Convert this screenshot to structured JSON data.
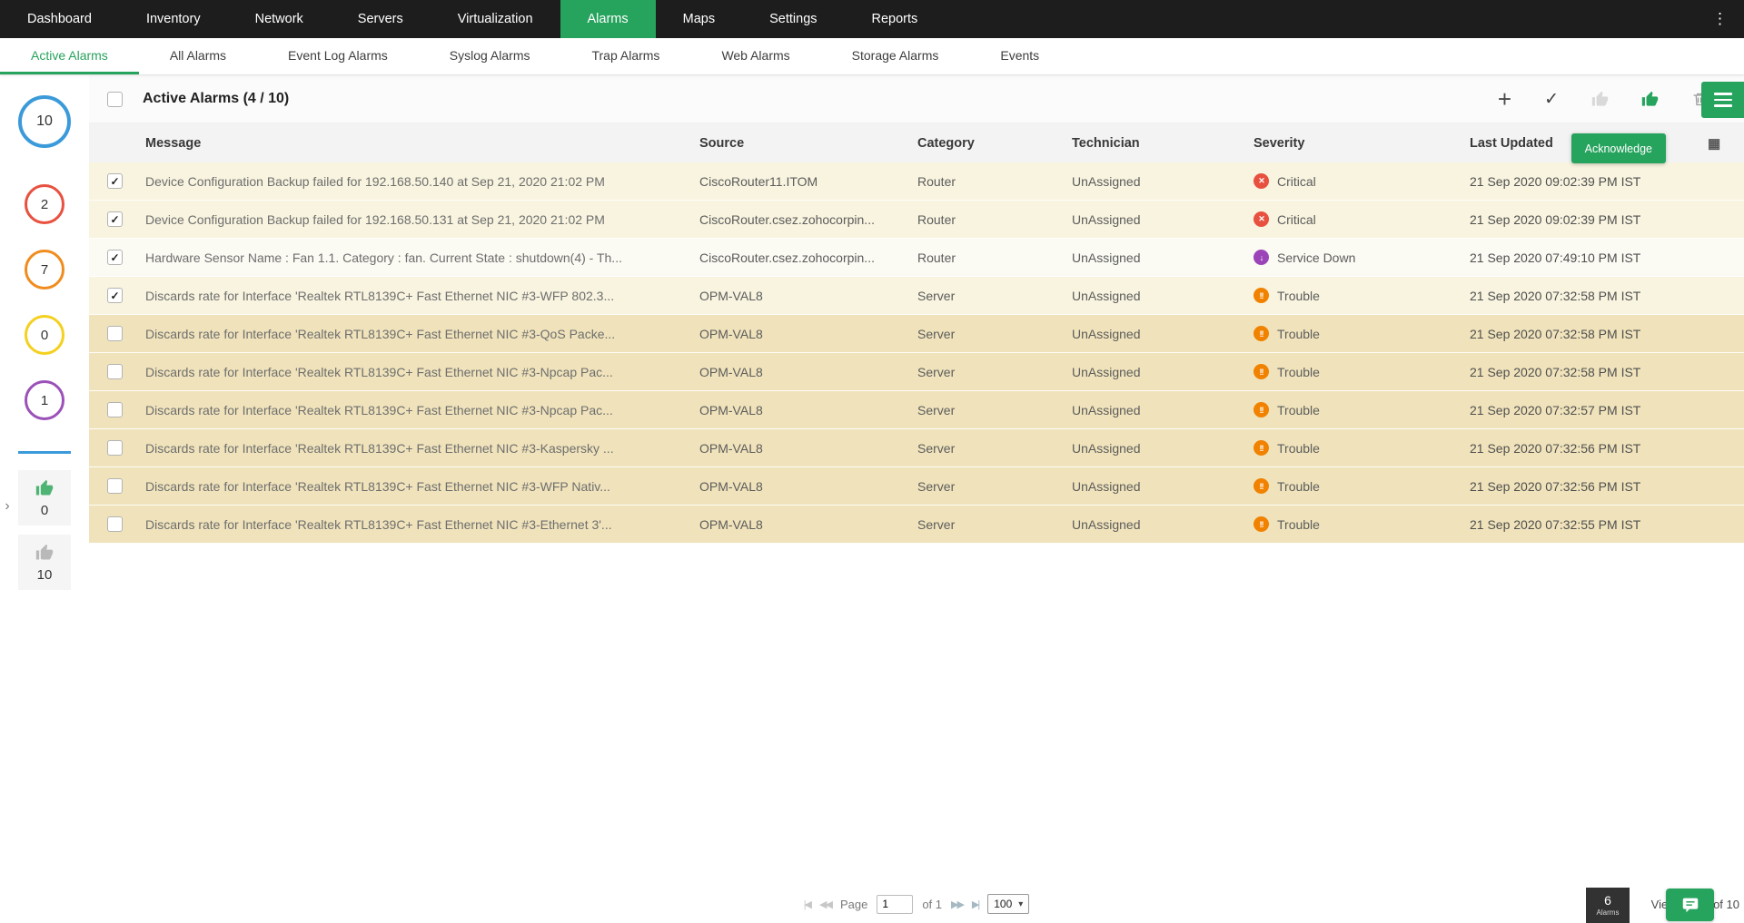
{
  "colors": {
    "accent": "#26a35d",
    "topnav_bg": "#1d1d1d"
  },
  "icons": {
    "overflow_menu": "⋮",
    "plus": "+",
    "check": "✓",
    "grid": "▦",
    "chevron": "›",
    "caret": "▾"
  },
  "topnav": {
    "active": "Alarms",
    "items": [
      "Dashboard",
      "Inventory",
      "Network",
      "Servers",
      "Virtualization",
      "Alarms",
      "Maps",
      "Settings",
      "Reports"
    ]
  },
  "subnav": {
    "active": "Active Alarms",
    "items": [
      "Active Alarms",
      "All Alarms",
      "Event Log Alarms",
      "Syslog Alarms",
      "Trap Alarms",
      "Web Alarms",
      "Storage Alarms",
      "Events"
    ]
  },
  "sidebar": {
    "severity_counts": [
      {
        "name": "all",
        "count": "10",
        "color": "#3b9ad9",
        "large": true
      },
      {
        "name": "critical",
        "count": "2",
        "color": "#e8503f",
        "large": false
      },
      {
        "name": "trouble",
        "count": "7",
        "color": "#f08c1e",
        "large": false
      },
      {
        "name": "attention",
        "count": "0",
        "color": "#f4d01f",
        "large": false
      },
      {
        "name": "service-down",
        "count": "1",
        "color": "#9b51b8",
        "large": false
      }
    ],
    "ack_stats": [
      {
        "name": "acknowledged",
        "count": "0",
        "color": "#4db474"
      },
      {
        "name": "unacknowledged",
        "count": "10",
        "color": "#b9b9b9"
      }
    ]
  },
  "header": {
    "title": "Active Alarms (4 / 10)",
    "tooltip": "Acknowledge"
  },
  "table": {
    "columns": {
      "message": "Message",
      "source": "Source",
      "category": "Category",
      "technician": "Technician",
      "severity": "Severity",
      "last_updated": "Last Updated"
    },
    "severity_styles": {
      "Critical": {
        "color": "#e8503f",
        "glyph": "✕"
      },
      "Service Down": {
        "color": "#9b44b8",
        "glyph": "↓"
      },
      "Trouble": {
        "color": "#f08200",
        "glyph": "!!"
      }
    },
    "rows": [
      {
        "checked": true,
        "bg": "#f8f4df",
        "message": "Device Configuration Backup failed for 192.168.50.140 at Sep 21, 2020 21:02 PM",
        "source": "CiscoRouter11.ITOM",
        "category": "Router",
        "technician": "UnAssigned",
        "severity": "Critical",
        "last_updated": "21 Sep 2020 09:02:39 PM IST"
      },
      {
        "checked": true,
        "bg": "#f8f4df",
        "message": "Device Configuration Backup failed for 192.168.50.131 at Sep 21, 2020 21:02 PM",
        "source": "CiscoRouter.csez.zohocorpin...",
        "category": "Router",
        "technician": "UnAssigned",
        "severity": "Critical",
        "last_updated": "21 Sep 2020 09:02:39 PM IST"
      },
      {
        "checked": true,
        "bg": "#fbfaf3",
        "message": "Hardware Sensor Name : Fan 1.1. Category : fan. Current State : shutdown(4) - Th...",
        "source": "CiscoRouter.csez.zohocorpin...",
        "category": "Router",
        "technician": "UnAssigned",
        "severity": "Service Down",
        "last_updated": "21 Sep 2020 07:49:10 PM IST"
      },
      {
        "checked": true,
        "bg": "#f8f4df",
        "message": "Discards rate for Interface 'Realtek RTL8139C+ Fast Ethernet NIC #3-WFP 802.3...",
        "source": "OPM-VAL8",
        "category": "Server",
        "technician": "UnAssigned",
        "severity": "Trouble",
        "last_updated": "21 Sep 2020 07:32:58 PM IST"
      },
      {
        "checked": false,
        "bg": "#f0e3bb",
        "message": "Discards rate for Interface 'Realtek RTL8139C+ Fast Ethernet NIC #3-QoS Packe...",
        "source": "OPM-VAL8",
        "category": "Server",
        "technician": "UnAssigned",
        "severity": "Trouble",
        "last_updated": "21 Sep 2020 07:32:58 PM IST"
      },
      {
        "checked": false,
        "bg": "#f0e3bb",
        "message": "Discards rate for Interface 'Realtek RTL8139C+ Fast Ethernet NIC #3-Npcap Pac...",
        "source": "OPM-VAL8",
        "category": "Server",
        "technician": "UnAssigned",
        "severity": "Trouble",
        "last_updated": "21 Sep 2020 07:32:58 PM IST"
      },
      {
        "checked": false,
        "bg": "#f0e3bb",
        "message": "Discards rate for Interface 'Realtek RTL8139C+ Fast Ethernet NIC #3-Npcap Pac...",
        "source": "OPM-VAL8",
        "category": "Server",
        "technician": "UnAssigned",
        "severity": "Trouble",
        "last_updated": "21 Sep 2020 07:32:57 PM IST"
      },
      {
        "checked": false,
        "bg": "#f0e3bb",
        "message": "Discards rate for Interface 'Realtek RTL8139C+ Fast Ethernet NIC #3-Kaspersky ...",
        "source": "OPM-VAL8",
        "category": "Server",
        "technician": "UnAssigned",
        "severity": "Trouble",
        "last_updated": "21 Sep 2020 07:32:56 PM IST"
      },
      {
        "checked": false,
        "bg": "#f0e3bb",
        "message": "Discards rate for Interface 'Realtek RTL8139C+ Fast Ethernet NIC #3-WFP Nativ...",
        "source": "OPM-VAL8",
        "category": "Server",
        "technician": "UnAssigned",
        "severity": "Trouble",
        "last_updated": "21 Sep 2020 07:32:56 PM IST"
      },
      {
        "checked": false,
        "bg": "#f0e3bb",
        "message": "Discards rate for Interface 'Realtek RTL8139C+ Fast Ethernet NIC #3-Ethernet 3'...",
        "source": "OPM-VAL8",
        "category": "Server",
        "technician": "UnAssigned",
        "severity": "Trouble",
        "last_updated": "21 Sep 2020 07:32:55 PM IST"
      }
    ]
  },
  "pagination": {
    "first_icon": "|◀",
    "prev_icon": "◀◀",
    "page_label": "Page",
    "page_value": "1",
    "of_text": "of 1",
    "next_icon": "▶▶",
    "last_icon": "▶|",
    "page_size": "100"
  },
  "footer": {
    "alarm_count": "6",
    "alarm_label": "Alarms",
    "records_text": "View 1 - 10 of 10"
  }
}
